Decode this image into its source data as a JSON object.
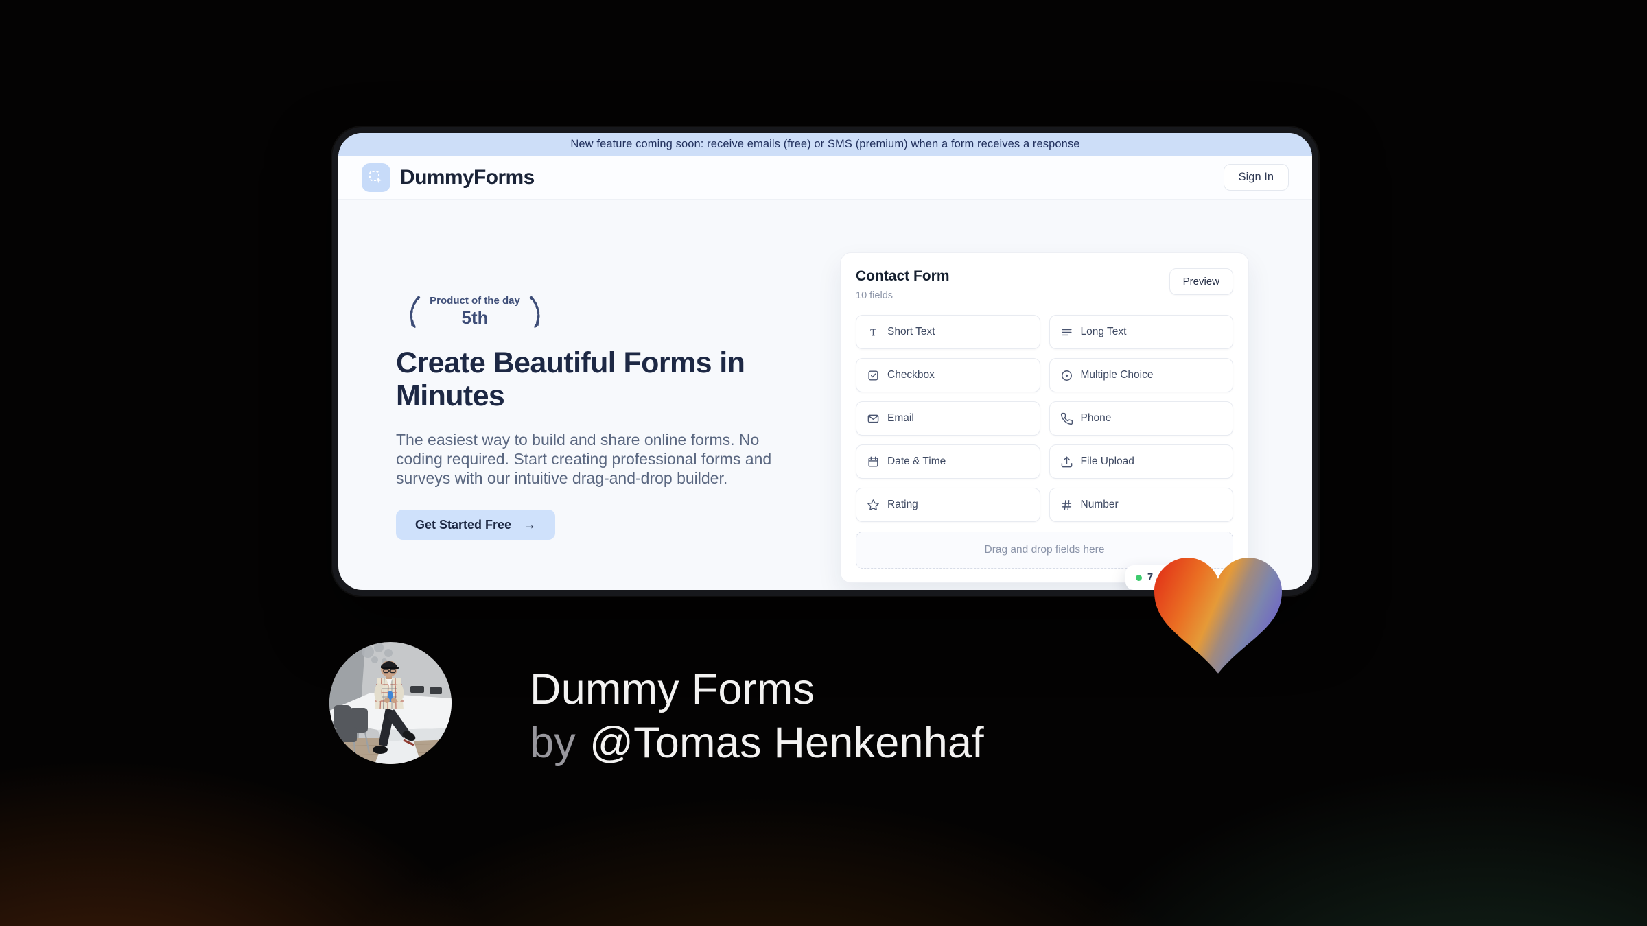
{
  "banner": {
    "text": "New feature coming soon: receive emails (free) or SMS (premium) when a form receives a response"
  },
  "header": {
    "brand": "DummyForms",
    "sign_in": "Sign In"
  },
  "hero": {
    "award_title": "Product of the day",
    "award_rank": "5th",
    "heading": "Create Beautiful Forms in Minutes",
    "description": "The easiest way to build and share online forms. No coding required. Start creating professional forms and surveys with our intuitive drag-and-drop builder.",
    "cta": "Get Started Free",
    "cta_arrow": "→"
  },
  "builder": {
    "title": "Contact Form",
    "field_count": "10 fields",
    "preview": "Preview",
    "fields": [
      {
        "label": "Short Text",
        "icon": "short-text-icon"
      },
      {
        "label": "Long Text",
        "icon": "long-text-icon"
      },
      {
        "label": "Checkbox",
        "icon": "checkbox-icon"
      },
      {
        "label": "Multiple Choice",
        "icon": "radio-icon"
      },
      {
        "label": "Email",
        "icon": "envelope-icon"
      },
      {
        "label": "Phone",
        "icon": "phone-icon"
      },
      {
        "label": "Date & Time",
        "icon": "calendar-icon"
      },
      {
        "label": "File Upload",
        "icon": "upload-icon"
      },
      {
        "label": "Rating",
        "icon": "star-icon"
      },
      {
        "label": "Number",
        "icon": "hash-icon"
      }
    ],
    "dropzone": "Drag and drop fields here",
    "status_badge": {
      "text": "7",
      "dot_color": "#3ecb6e"
    }
  },
  "caption": {
    "line1": "Dummy Forms",
    "line2_prefix": "by",
    "line2_name": "@Tomas Henkenhaf"
  },
  "colors": {
    "banner_bg": "#cddef8",
    "accent_light_blue": "#cfe1fb",
    "brand_navy": "#1a2337",
    "laurel_blue": "#3d4d77",
    "heart_red": "#e23318",
    "heart_orange": "#f09a2e",
    "heart_blue": "#7c85ae",
    "heart_purple": "#6e63c8",
    "status_green": "#3ecb6e"
  }
}
